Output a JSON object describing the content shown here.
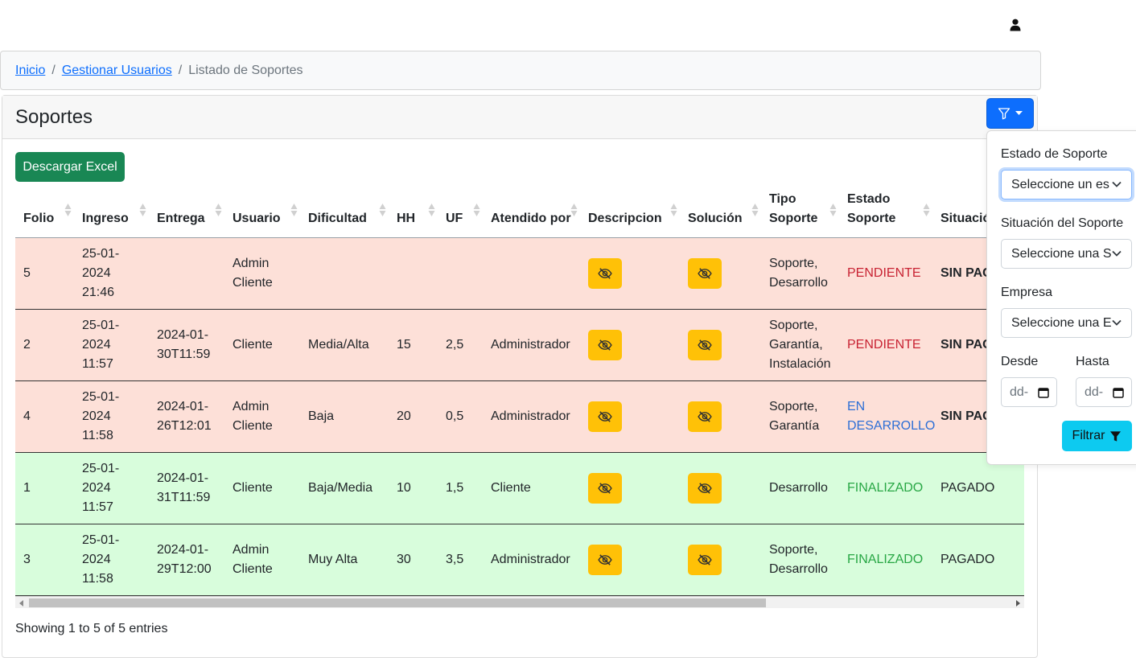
{
  "breadcrumb": {
    "home": "Inicio",
    "manage": "Gestionar Usuarios",
    "current": "Listado de Soportes",
    "separator": "/"
  },
  "card": {
    "title": "Soportes"
  },
  "actions": {
    "excel_label": "Descargar Excel"
  },
  "table": {
    "columns": [
      "Folio",
      "Ingreso",
      "Entrega",
      "Usuario",
      "Dificultad",
      "HH",
      "UF",
      "Atendido por",
      "Descripcion",
      "Solución",
      "Tipo Soporte",
      "Estado Soporte",
      "Situación"
    ],
    "rows": [
      {
        "folio": "5",
        "ingreso": "25-01-2024 21:46",
        "entrega": "",
        "usuario": "Admin Cliente",
        "dificultad": "",
        "hh": "",
        "uf": "",
        "atendido": "",
        "tipo": "Soporte, Desarrollo",
        "estado": "PENDIENTE",
        "situacion": "SIN PAGO"
      },
      {
        "folio": "2",
        "ingreso": "25-01-2024 11:57",
        "entrega": "2024-01-30T11:59",
        "usuario": "Cliente",
        "dificultad": "Media/Alta",
        "hh": "15",
        "uf": "2,5",
        "atendido": "Administrador",
        "tipo": "Soporte, Garantía, Instalación",
        "estado": "PENDIENTE",
        "situacion": "SIN PAGO"
      },
      {
        "folio": "4",
        "ingreso": "25-01-2024 11:58",
        "entrega": "2024-01-26T12:01",
        "usuario": "Admin Cliente",
        "dificultad": "Baja",
        "hh": "20",
        "uf": "0,5",
        "atendido": "Administrador",
        "tipo": "Soporte, Garantía",
        "estado": "EN DESARROLLO",
        "situacion": "SIN PAGO"
      },
      {
        "folio": "1",
        "ingreso": "25-01-2024 11:57",
        "entrega": "2024-01-31T11:59",
        "usuario": "Cliente",
        "dificultad": "Baja/Media",
        "hh": "10",
        "uf": "1,5",
        "atendido": "Cliente",
        "tipo": "Desarrollo",
        "estado": "FINALIZADO",
        "situacion": "PAGADO"
      },
      {
        "folio": "3",
        "ingreso": "25-01-2024 11:58",
        "entrega": "2024-01-29T12:00",
        "usuario": "Admin Cliente",
        "dificultad": "Muy Alta",
        "hh": "30",
        "uf": "3,5",
        "atendido": "Administrador",
        "tipo": "Soporte, Desarrollo",
        "estado": "FINALIZADO",
        "situacion": "PAGADO"
      }
    ]
  },
  "footer": {
    "entries": "Showing 1 to 5 of 5 entries"
  },
  "filter": {
    "estado_label": "Estado de Soporte",
    "estado_value": "Seleccione un es",
    "situacion_label": "Situación del Soporte",
    "situacion_value": "Seleccione una S",
    "empresa_label": "Empresa",
    "empresa_value": "Seleccione una E",
    "desde_label": "Desde",
    "hasta_label": "Hasta",
    "desde_value": "dd-",
    "hasta_value": "dd-",
    "submit_label": "Filtrar"
  },
  "icons": {
    "user": "user-icon",
    "filter": "filter-icon",
    "caret": "caret-down-icon",
    "eye_slash": "eye-slash-icon",
    "chevron": "chevron-down-icon",
    "calendar": "calendar-icon",
    "funnel": "funnel-fill-icon",
    "sort": "sort-icon"
  },
  "colors": {
    "primary": "#0d6efd",
    "success": "#198754",
    "warning": "#ffc107",
    "info": "#0dcaf0",
    "row_pending": "#fde0d8",
    "row_done": "#d8fddc",
    "status_pending": "#c82333",
    "status_dev": "#2d6fd6",
    "status_done": "#28a745"
  }
}
